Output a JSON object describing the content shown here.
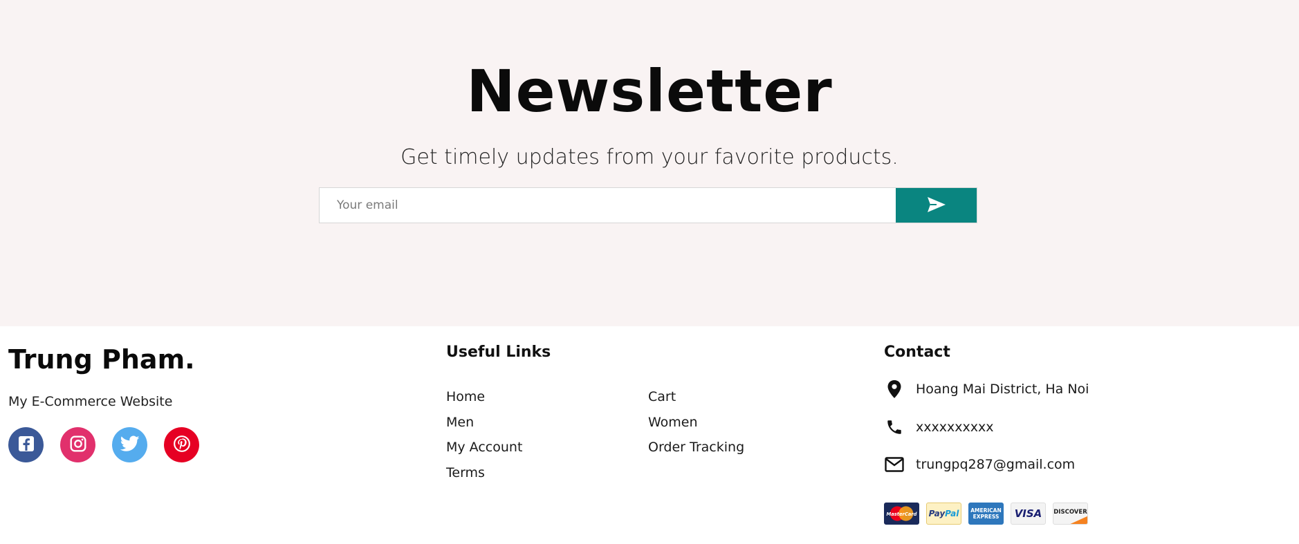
{
  "newsletter": {
    "title": "Newsletter",
    "subtitle": "Get timely updates from your favorite products.",
    "email_placeholder": "Your email",
    "submit_icon": "send-icon",
    "accent_color": "#0a8580",
    "background_color": "#f9f3f3"
  },
  "footer": {
    "brand": "Trung Pham.",
    "tagline": "My E-Commerce Website",
    "socials": [
      {
        "name": "facebook",
        "icon": "facebook-icon",
        "color": "#3b5998"
      },
      {
        "name": "instagram",
        "icon": "instagram-icon",
        "color": "#e1306c"
      },
      {
        "name": "twitter",
        "icon": "twitter-icon",
        "color": "#55acee"
      },
      {
        "name": "pinterest",
        "icon": "pinterest-icon",
        "color": "#e60023"
      }
    ],
    "useful_links": {
      "title": "Useful Links",
      "links": [
        "Home",
        "Cart",
        "Men",
        "Women",
        "My Account",
        "Order Tracking",
        "Terms"
      ]
    },
    "contact": {
      "title": "Contact",
      "address": "Hoang Mai District, Ha Noi",
      "phone": "xxxxxxxxxx",
      "email": "trungpq287@gmail.com",
      "icons": [
        "location-pin-icon",
        "phone-icon",
        "mail-icon"
      ]
    },
    "payments": [
      "MasterCard",
      "PayPal",
      "AMERICAN EXPRESS",
      "VISA",
      "DISCOVER"
    ]
  }
}
